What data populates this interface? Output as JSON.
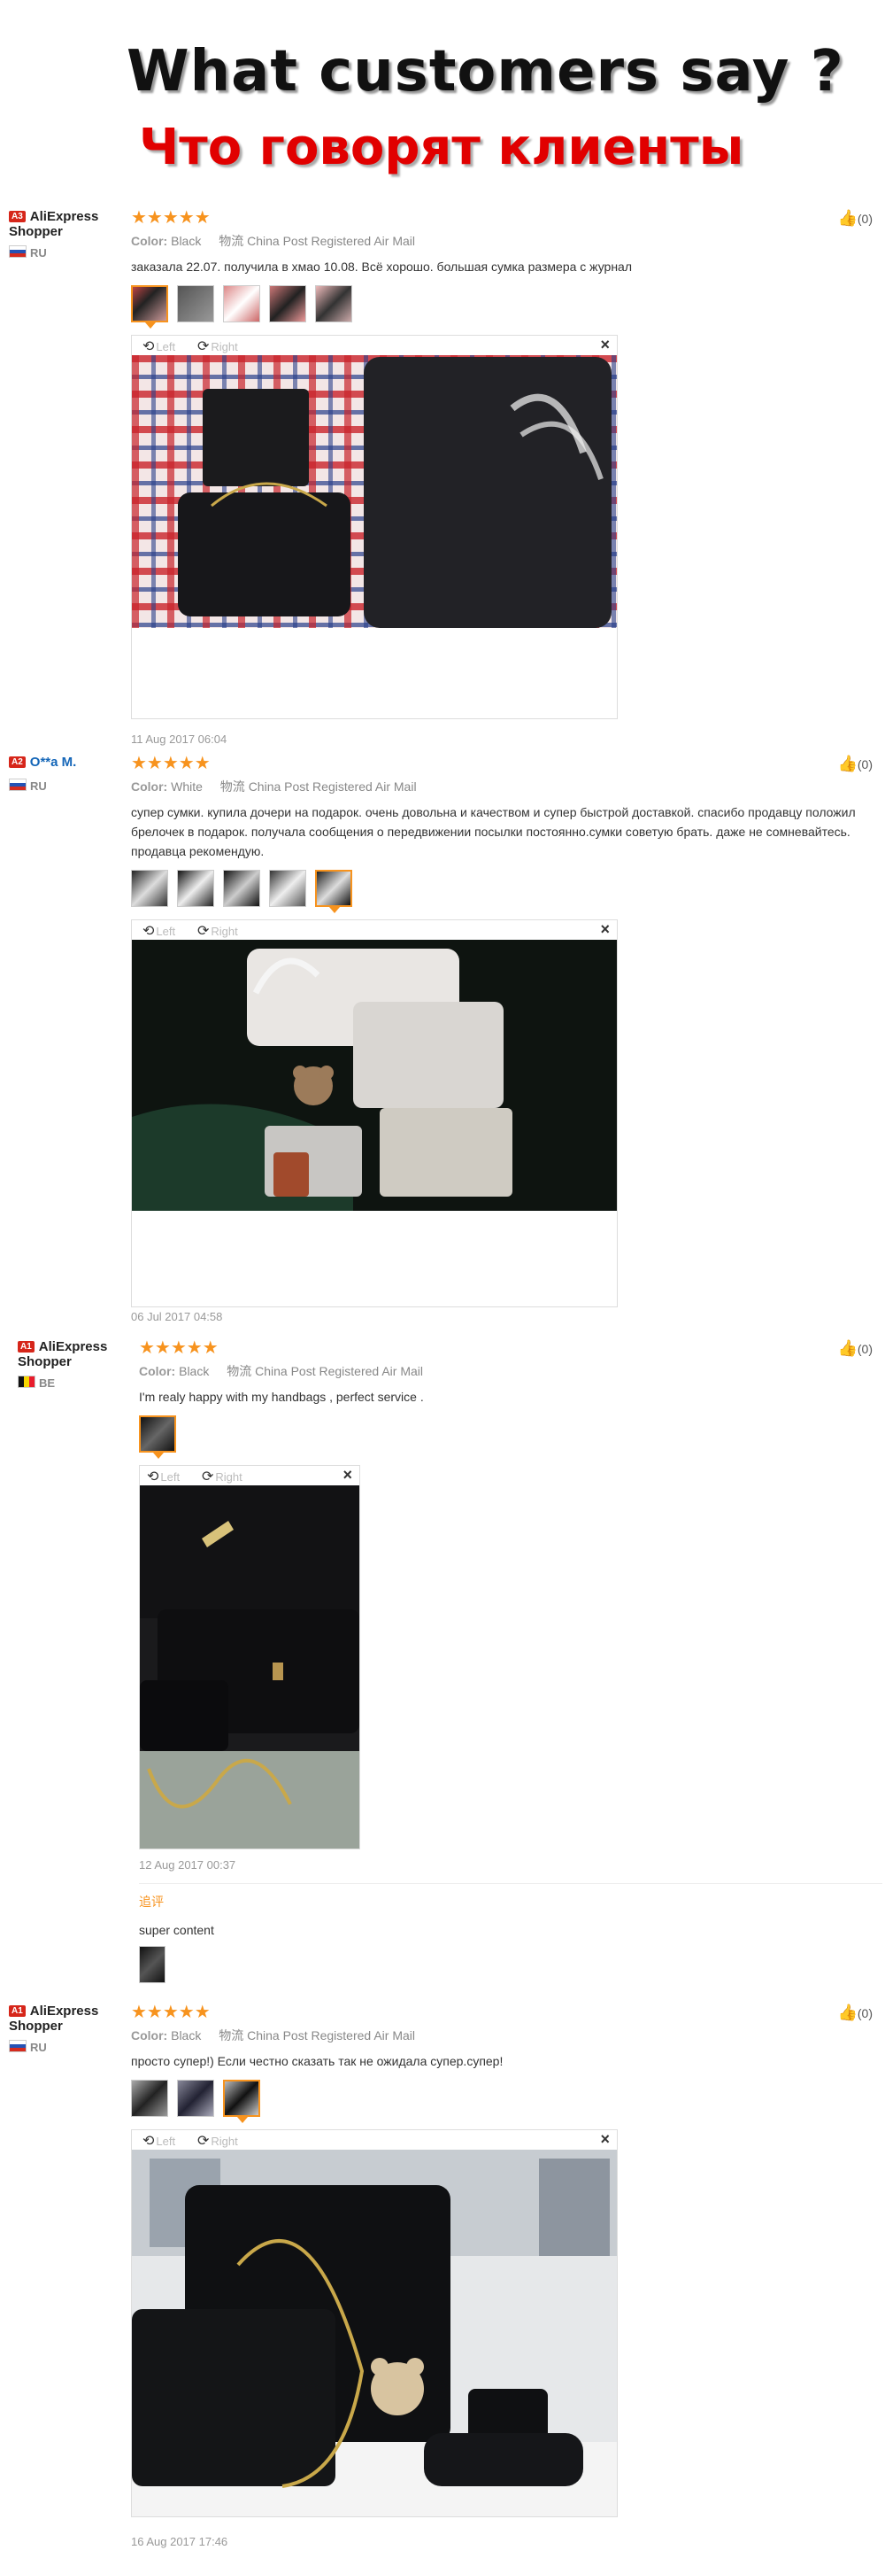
{
  "header": {
    "title_en": "What customers say ?",
    "title_ru": "Что говорят клиенты"
  },
  "colors": {
    "accent": "#f7931e",
    "badge": "#d6261a",
    "title_red": "#e10000",
    "user_blue": "#1466b8"
  },
  "reviews": [
    {
      "badge": "A3",
      "user": "AliExpress Shopper",
      "country": "RU",
      "stars": "★★★★★",
      "color_label": "Color:",
      "color": "Black",
      "shipping_icon": "物流",
      "shipping": "China Post Registered Air Mail",
      "text": "заказала 22.07. получила в хмао 10.08. Всё хорошо. большая сумка размера с журнал",
      "viewer_left": "Left",
      "viewer_right": "Right",
      "close": "×",
      "date": "11 Aug 2017 06:04",
      "likes": "(0)"
    },
    {
      "badge": "A2",
      "user": "O**a M.",
      "country": "RU",
      "stars": "★★★★★",
      "color_label": "Color:",
      "color": "White",
      "shipping_icon": "物流",
      "shipping": "China Post Registered Air Mail",
      "text": "супер сумки. купила дочери на подарок. очень довольна и качеством и супер быстрой доставкой. спасибо продавцу положил брелочек в подарок. получала сообщения о передвижении посылки постоянно.сумки советую брать. даже не сомневайтесь. продавца рекомендую.",
      "viewer_left": "Left",
      "viewer_right": "Right",
      "close": "×",
      "date": "06 Jul 2017 04:58",
      "likes": "(0)"
    },
    {
      "badge": "A1",
      "user": "AliExpress Shopper",
      "country": "BE",
      "stars": "★★★★★",
      "color_label": "Color:",
      "color": "Black",
      "shipping_icon": "物流",
      "shipping": "China Post Registered Air Mail",
      "text": "I'm realy happy with my handbags , perfect service .",
      "viewer_left": "Left",
      "viewer_right": "Right",
      "close": "×",
      "date": "12 Aug 2017 00:37",
      "likes": "(0)",
      "followup_label": "追评",
      "followup_text": "super content"
    },
    {
      "badge": "A1",
      "user": "AliExpress Shopper",
      "country": "RU",
      "stars": "★★★★★",
      "color_label": "Color:",
      "color": "Black",
      "shipping_icon": "物流",
      "shipping": "China Post Registered Air Mail",
      "text": "просто супер!) Если честно сказать так не ожидала супер.супер!",
      "viewer_left": "Left",
      "viewer_right": "Right",
      "close": "×",
      "date": "16 Aug 2017 17:46",
      "likes": "(0)"
    }
  ]
}
